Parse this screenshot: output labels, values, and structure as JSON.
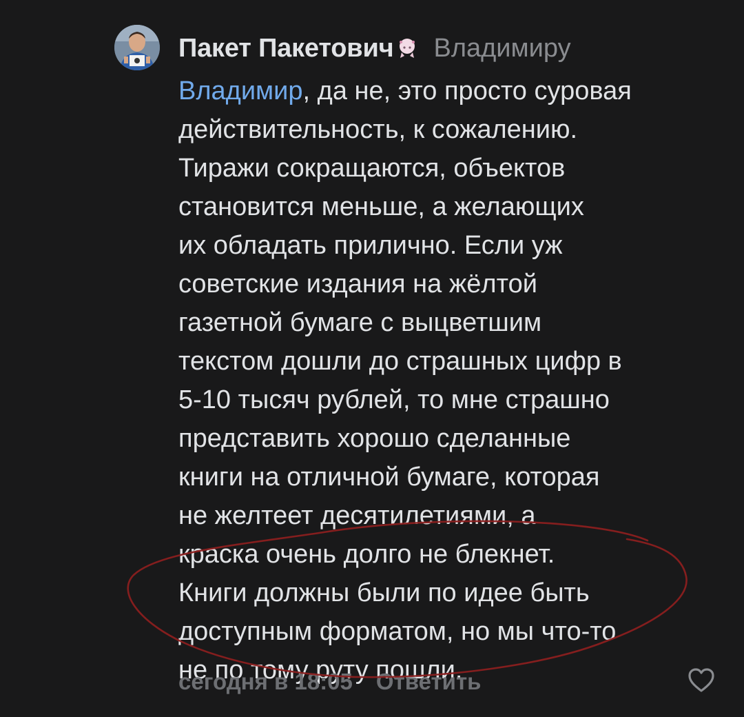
{
  "comment": {
    "author": "Пакет Пакетович",
    "reply_to": "Владимиру",
    "mention": "Владимир",
    "line_1_rest": ", да не, это просто суровая",
    "lines": [
      "действительность, к сожалению.",
      "Тиражи сокращаются, объектов",
      "становится меньше, а желающих",
      "их обладать прилично. Если уж",
      "советские издания на жёлтой",
      "газетной бумаге с выцветшим",
      "текстом дошли до страшных цифр в",
      "5-10 тысяч рублей, то мне страшно",
      "представить хорошо сделанные",
      "книги на отличной бумаге, которая",
      "не желтеет десятилетиями, а",
      "краска очень долго не блекнет.",
      "Книги должны были по идее быть",
      "доступным форматом, но мы что-то",
      "не по тому руту пошли."
    ],
    "timestamp": "сегодня в 18:05",
    "reply_label": "Ответить"
  },
  "colors": {
    "background": "#19191a",
    "text": "#e1e3e6",
    "mention": "#71aaeb",
    "muted": "#6d6f73",
    "annotation": "#8b1f1f"
  },
  "icons": {
    "avatar": "user-avatar",
    "badge": "anime-girl-sticker-icon",
    "like": "heart-outline-icon"
  }
}
